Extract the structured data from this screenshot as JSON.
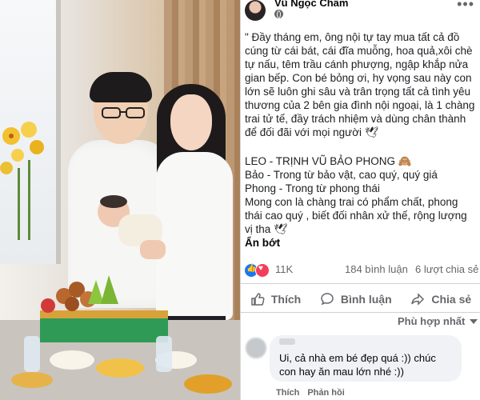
{
  "post": {
    "author": "Vũ Ngọc Châm",
    "body": [
      "\" Đầy tháng em, ông nội tự tay mua tất cả đồ cúng từ cái bát, cái đĩa muỗng, hoa quả,xôi chè tự nấu, têm trầu cánh phượng, ngập khắp nửa gian bếp. Con bé bỏng ơi, hy vọng sau này con lớn sẽ luôn ghi sâu và trân trọng tất cả tình yêu thương của 2 bên gia đình nội ngoại, là 1 chàng trai tử tế, đầy trách nhiệm và dùng chân thành để đối đãi với mọi người 🕊",
      "LEO - TRỊNH VŨ BẢO PHONG 🙈",
      "Bảo - Trong từ bảo vật, cao quý, quý giá",
      "Phong - Trong từ phong thái",
      "Mong con là chàng trai có phẩm chất, phong thái cao quý , biết đối nhân xử thế, rộng lượng vị tha 🕊"
    ],
    "see_less": "Ẩn bớt",
    "reactions": "11K",
    "comments": "184 bình luận",
    "shares": "6 lượt chia sẻ"
  },
  "actions": {
    "like": "Thích",
    "comment": "Bình luận",
    "share": "Chia sẻ"
  },
  "sort_label": "Phù hợp nhất",
  "comment": {
    "text": "Ui, cả nhà em bé đẹp quá :)) chúc con hay ăn mau lớn nhé :))",
    "like": "Thích",
    "reply": "Phản hồi"
  },
  "colors": {
    "like_blue": "#1877f2",
    "love_red": "#f33e58",
    "muted": "#65676b"
  }
}
